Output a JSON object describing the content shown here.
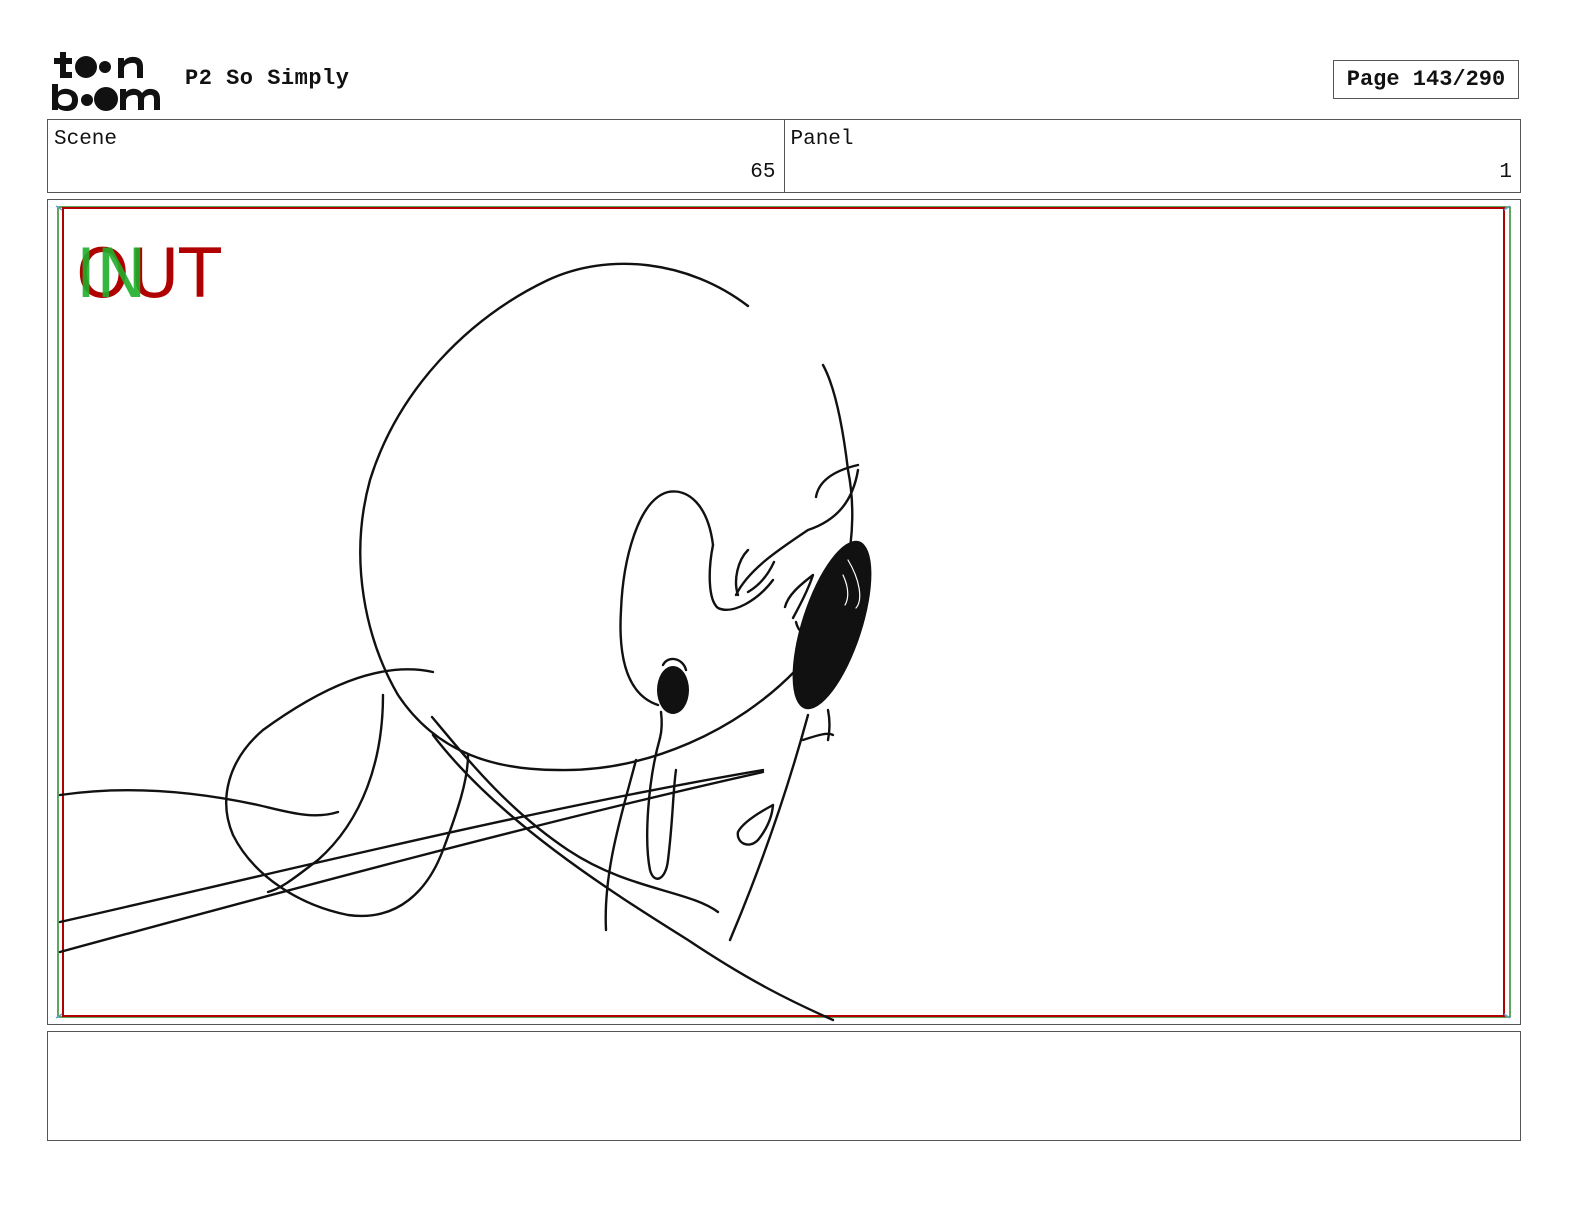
{
  "header": {
    "logo_text": "toon boom",
    "project_title": "P2 So Simply",
    "page_label": "Page 143/290"
  },
  "info": {
    "scene_label": "Scene",
    "scene_value": "65",
    "panel_label": "Panel",
    "panel_value": "1"
  },
  "panel": {
    "in_marker": "IN",
    "out_marker": "OUT",
    "colors": {
      "in": "#1fae2a",
      "out": "#b00000",
      "frame": "#b00000",
      "guide": "#2a8a2a"
    }
  },
  "caption": {
    "text": ""
  }
}
